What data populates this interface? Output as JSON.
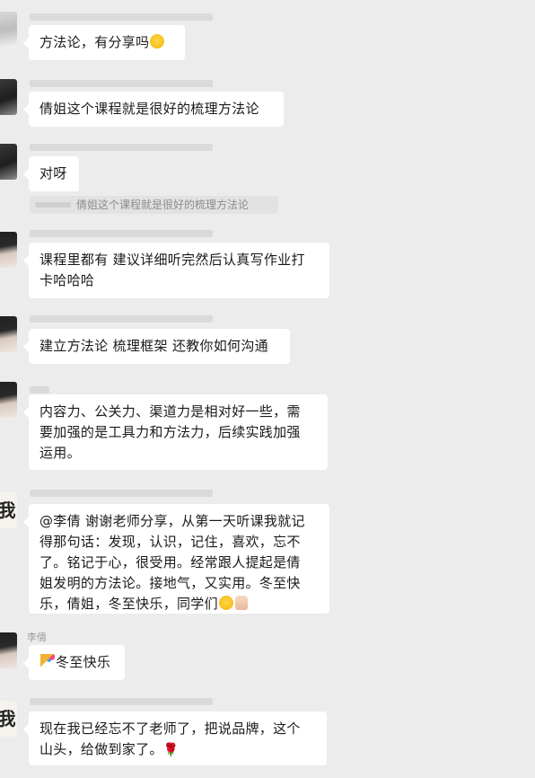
{
  "messages": [
    {
      "sender": "",
      "lines": [
        "方法论，有分享吗"
      ],
      "emoji": "grinning-face-emoji"
    },
    {
      "sender": "",
      "lines": [
        "倩姐这个课程就是很好的梳理方法论"
      ]
    },
    {
      "sender": "",
      "lines": [
        "对呀"
      ],
      "quote": "倩姐这个课程就是很好的梳理方法论"
    },
    {
      "sender": "",
      "lines": [
        "课程里都有 建议详细听完然后认真写作业打",
        "卡哈哈哈"
      ]
    },
    {
      "sender": "",
      "lines": [
        "建立方法论 梳理框架 还教你如何沟通"
      ]
    },
    {
      "sender": "",
      "lines": [
        "内容力、公关力、渠道力是相对好一些，需",
        "要加强的是工具力和方法力，后续实践加强",
        "运用。"
      ]
    },
    {
      "sender": "",
      "lines": [
        "@李倩 谢谢老师分享，从第一天听课我就记",
        "得那句话：发现，认识，记住，喜欢，忘不",
        "了。铭记于心，很受用。经常跟人提起是倩",
        "姐发明的方法论。接地气，又实用。冬至快",
        "乐，倩姐，冬至快乐，同学们"
      ],
      "emoji": [
        "grinning-face-emoji",
        "thumbs-up-emoji"
      ]
    },
    {
      "sender": "李倩",
      "lines": [
        "冬至快乐"
      ],
      "emoji": "party-popper-emoji"
    },
    {
      "sender": "",
      "lines": [
        "现在我已经忘不了老师了，把说品牌，这个",
        "山头，给做到家了。"
      ],
      "emoji": "rose-emoji"
    }
  ],
  "avatars": {
    "calligraphy_char": "我"
  },
  "colors": {
    "background": "#ececec",
    "bubble": "#ffffff",
    "text": "#1a1a1a",
    "muted": "#9a9a9a"
  }
}
